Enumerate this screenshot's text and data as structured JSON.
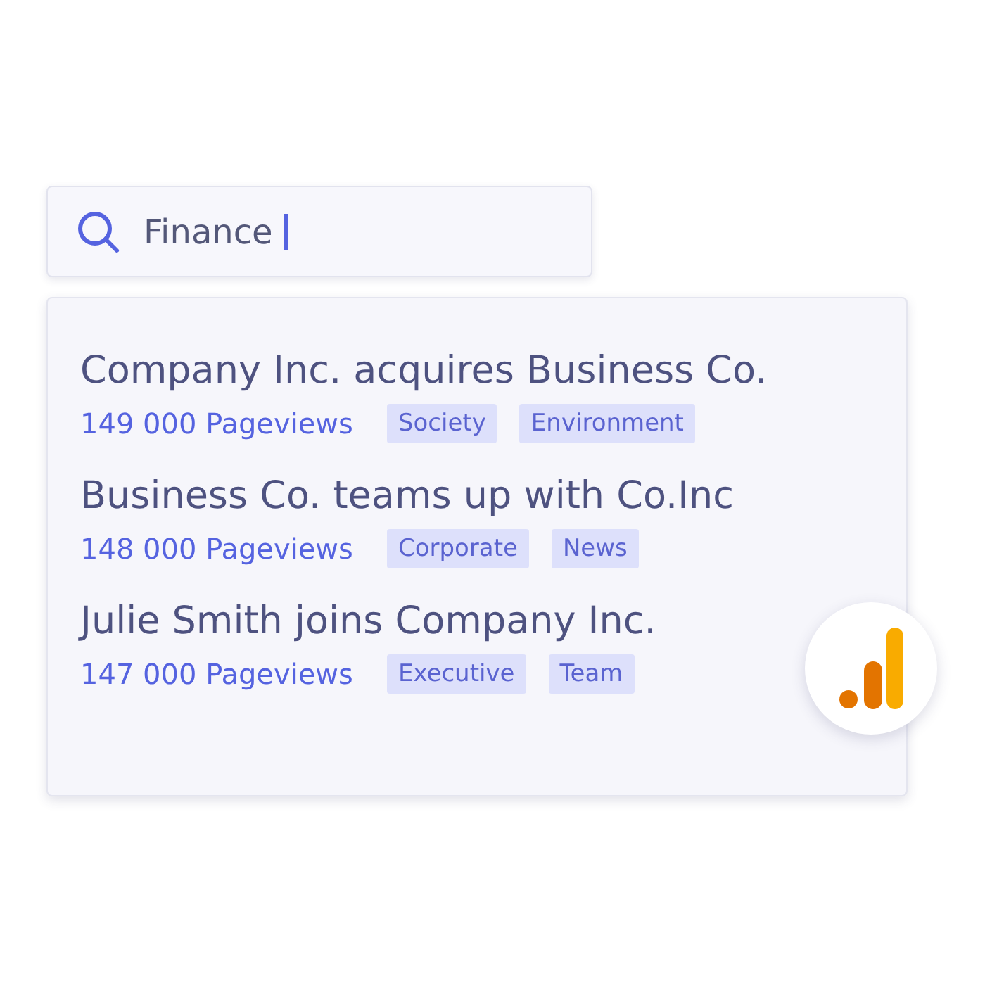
{
  "search": {
    "value": "Finance"
  },
  "results": [
    {
      "title": "Company Inc. acquires Business Co.",
      "pageviews": "149 000 Pageviews",
      "tags": [
        "Society",
        "Environment"
      ]
    },
    {
      "title": "Business Co. teams up with Co.Inc",
      "pageviews": "148 000 Pageviews",
      "tags": [
        "Corporate",
        "News"
      ]
    },
    {
      "title": "Julie Smith joins Company Inc.",
      "pageviews": "147 000 Pageviews",
      "tags": [
        "Executive",
        "Team"
      ]
    }
  ]
}
